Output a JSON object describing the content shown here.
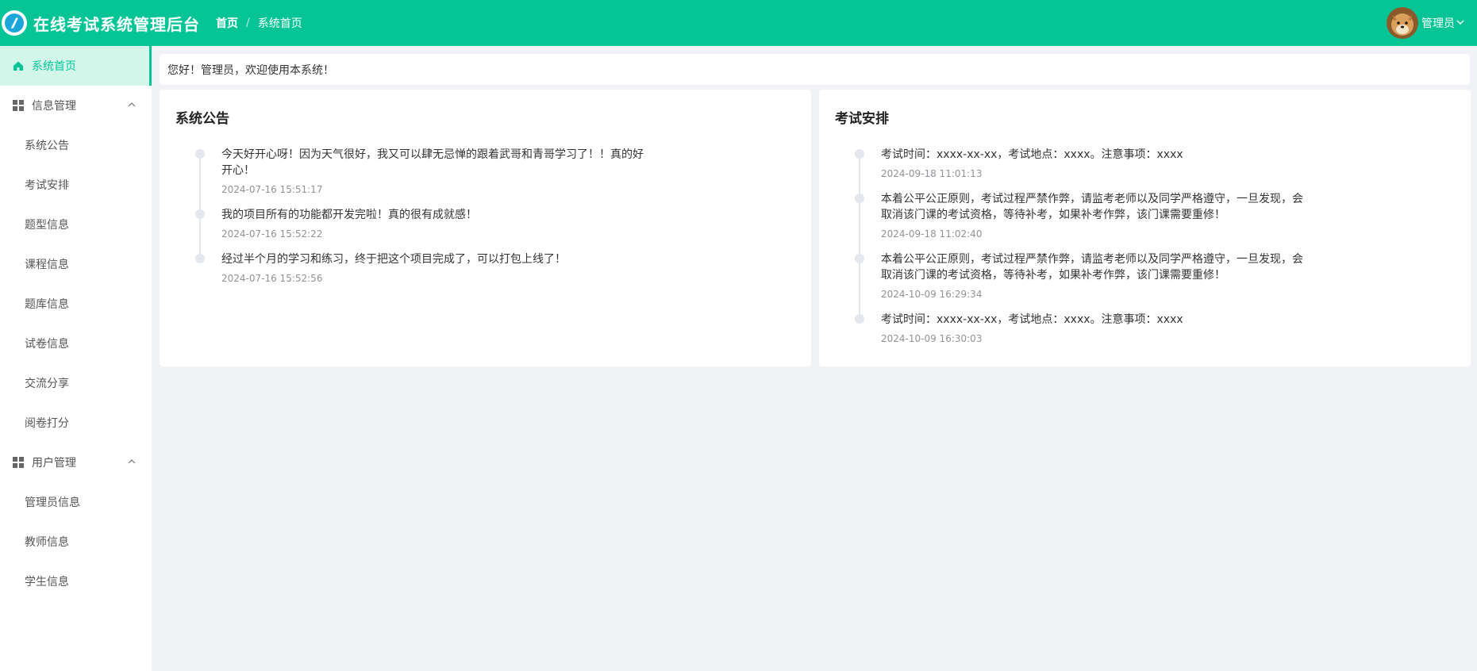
{
  "header": {
    "title": "在线考试系统管理后台",
    "breadcrumb": {
      "home": "首页",
      "current": "系统首页"
    },
    "user": {
      "name": "管理员",
      "avatar_icon": "avatar-icon"
    },
    "bg_color": "#05c496"
  },
  "sidebar": {
    "home": "系统首页",
    "groups": [
      {
        "label": "信息管理",
        "items": [
          "系统公告",
          "考试安排",
          "题型信息",
          "课程信息",
          "题库信息",
          "试卷信息",
          "交流分享",
          "阅卷打分"
        ]
      },
      {
        "label": "用户管理",
        "items": [
          "管理员信息",
          "教师信息",
          "学生信息"
        ]
      }
    ]
  },
  "welcome": "您好！管理员，欢迎使用本系统！",
  "notices": {
    "title": "系统公告",
    "items": [
      {
        "content": "今天好开心呀！因为天气很好，我又可以肆无忌惮的跟着武哥和青哥学习了！！真的好开心！",
        "time": "2024-07-16 15:51:17"
      },
      {
        "content": "我的项目所有的功能都开发完啦！真的很有成就感！",
        "time": "2024-07-16 15:52:22"
      },
      {
        "content": "经过半个月的学习和练习，终于把这个项目完成了，可以打包上线了！",
        "time": "2024-07-16 15:52:56"
      }
    ]
  },
  "exams": {
    "title": "考试安排",
    "items": [
      {
        "content": "考试时间：xxxx-xx-xx，考试地点：xxxx。注意事项：xxxx",
        "time": "2024-09-18 11:01:13"
      },
      {
        "content": "本着公平公正原则，考试过程严禁作弊，请监考老师以及同学严格遵守，一旦发现，会取消该门课的考试资格，等待补考，如果补考作弊，该门课需要重修！",
        "time": "2024-09-18 11:02:40"
      },
      {
        "content": "本着公平公正原则，考试过程严禁作弊，请监考老师以及同学严格遵守，一旦发现，会取消该门课的考试资格，等待补考，如果补考作弊，该门课需要重修！",
        "time": "2024-10-09 16:29:34"
      },
      {
        "content": "考试时间：xxxx-xx-xx，考试地点：xxxx。注意事项：xxxx",
        "time": "2024-10-09 16:30:03"
      }
    ]
  }
}
